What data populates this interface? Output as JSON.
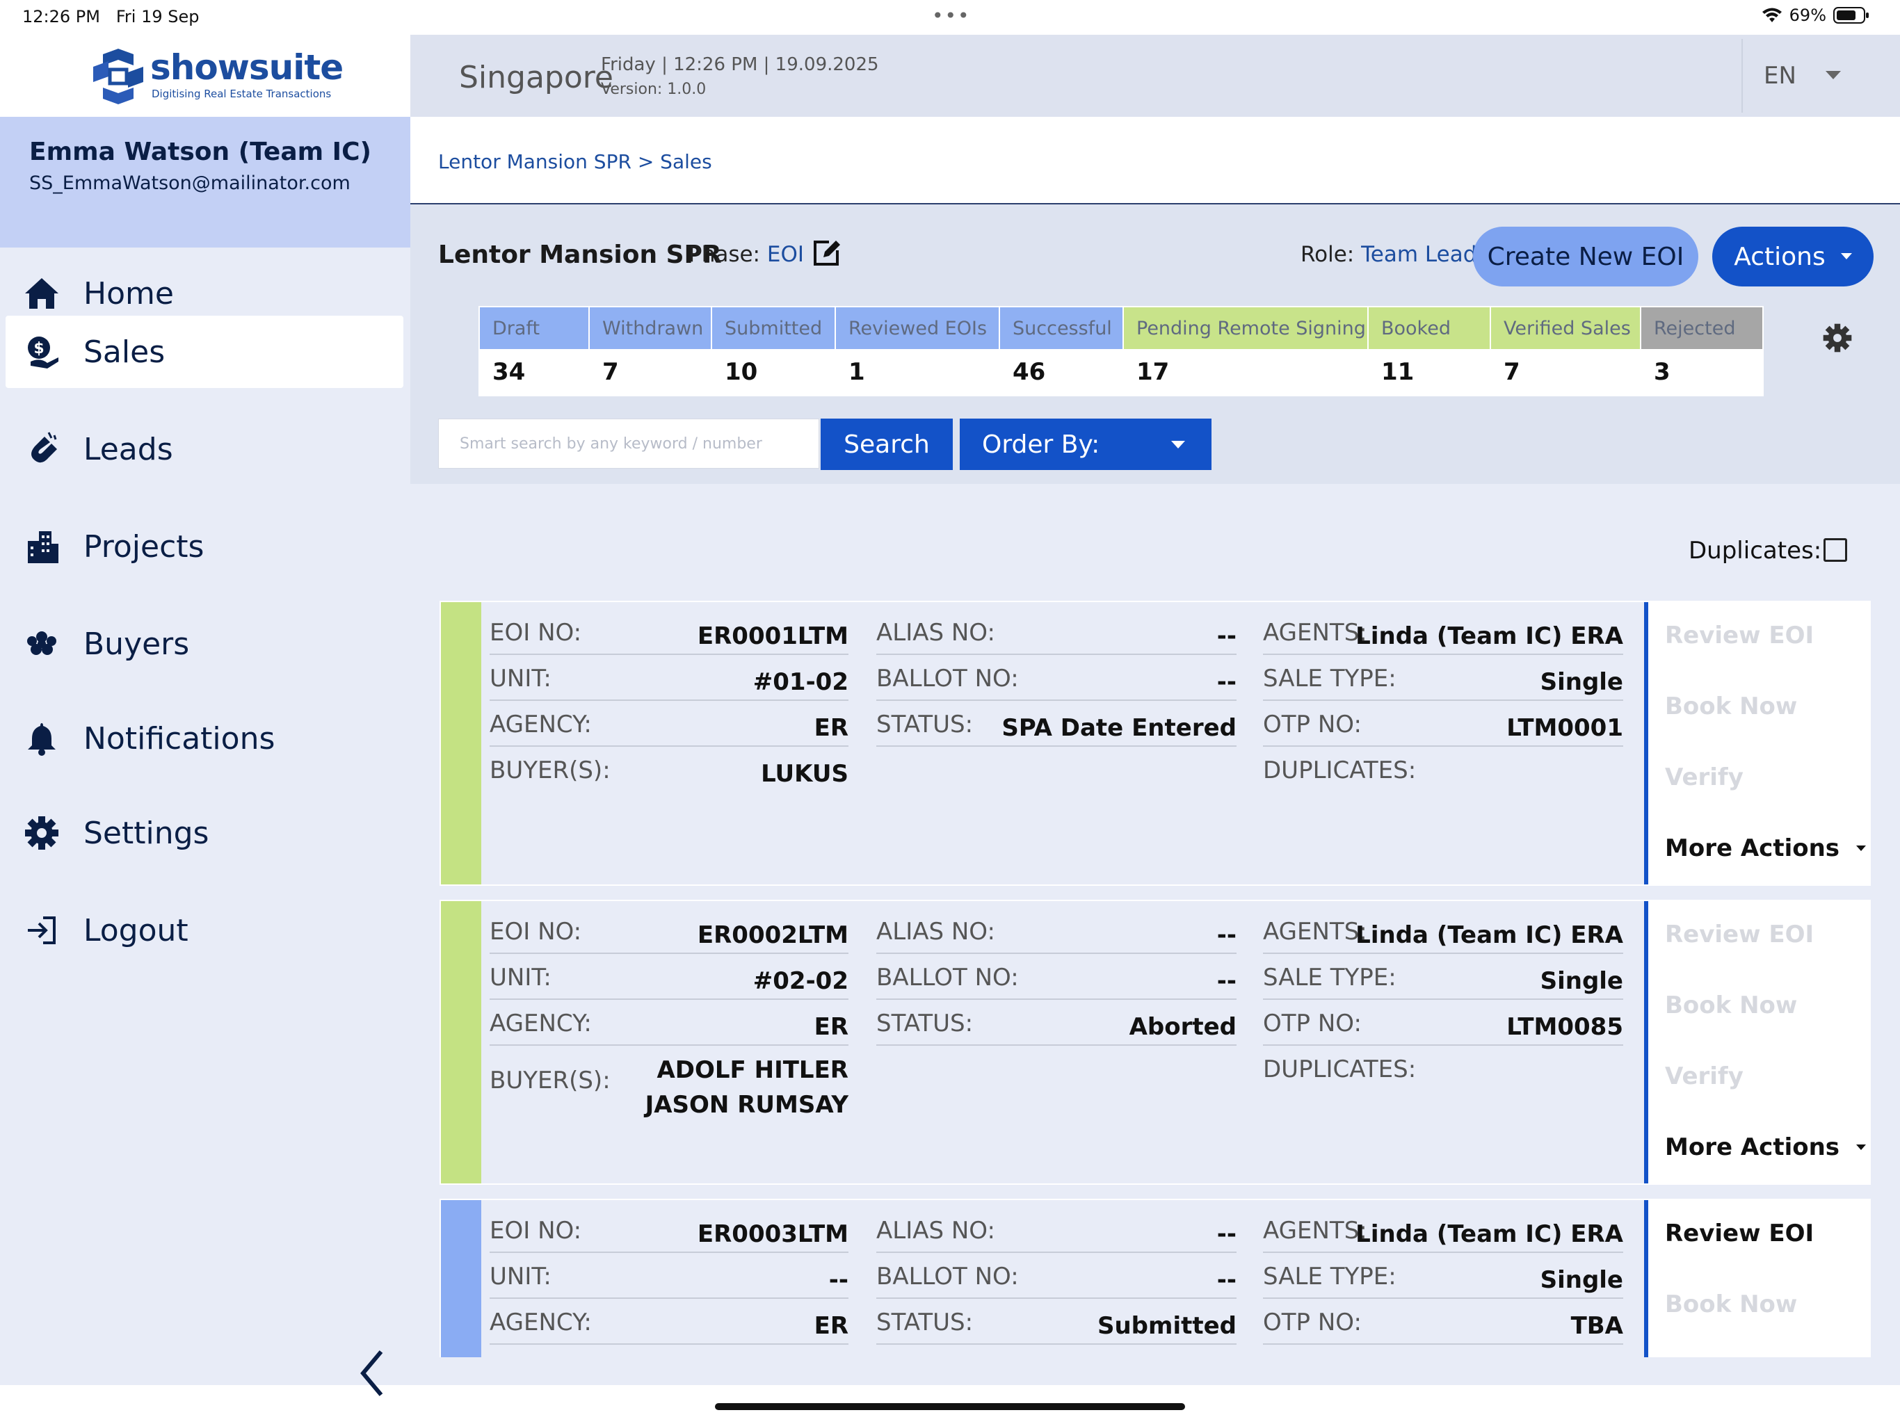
{
  "status_bar": {
    "time": "12:26 PM",
    "date": "Fri 19 Sep",
    "battery": "69%"
  },
  "app": {
    "logo_text": "showsuite",
    "logo_tagline": "Digitising Real Estate Transactions"
  },
  "user": {
    "name": "Emma Watson (Team IC)",
    "email": "SS_EmmaWatson@mailinator.com"
  },
  "nav": [
    {
      "label": "Home",
      "icon": "home-icon"
    },
    {
      "label": "Sales",
      "icon": "sales-icon",
      "active": true
    },
    {
      "label": "Leads",
      "icon": "magnet-icon"
    },
    {
      "label": "Projects",
      "icon": "buildings-icon"
    },
    {
      "label": "Buyers",
      "icon": "people-icon"
    },
    {
      "label": "Notifications",
      "icon": "bell-icon"
    },
    {
      "label": "Settings",
      "icon": "gear-icon"
    },
    {
      "label": "Logout",
      "icon": "logout-icon"
    }
  ],
  "header": {
    "city": "Singapore",
    "datetime": "Friday | 12:26 PM | 19.09.2025",
    "version": "Version: 1.0.0",
    "language": "EN"
  },
  "breadcrumb": "Lentor Mansion SPR > Sales",
  "project": {
    "name": "Lentor Mansion SPR",
    "phase_label": "Phase:",
    "phase_value": "EOI",
    "role_label": "Role:",
    "role_value": "Team Lead",
    "create_button": "Create New EOI",
    "actions_button": "Actions"
  },
  "stats": [
    {
      "label": "Draft",
      "value": "34",
      "color": "#8fb0f3"
    },
    {
      "label": "Withdrawn",
      "value": "7",
      "color": "#8fb0f3"
    },
    {
      "label": "Submitted",
      "value": "10",
      "color": "#8fb0f3"
    },
    {
      "label": "Reviewed EOIs",
      "value": "1",
      "color": "#8fb0f3"
    },
    {
      "label": "Successful",
      "value": "46",
      "color": "#8fb0f3"
    },
    {
      "label": "Pending Remote Signing",
      "value": "17",
      "color": "#c8e38a"
    },
    {
      "label": "Booked",
      "value": "11",
      "color": "#c8e38a"
    },
    {
      "label": "Verified Sales",
      "value": "7",
      "color": "#c8e38a"
    },
    {
      "label": "Rejected",
      "value": "3",
      "color": "#a6a6a6"
    }
  ],
  "search": {
    "placeholder": "Smart search by any keyword / number",
    "button": "Search",
    "order_by": "Order By:"
  },
  "duplicates_label": "Duplicates:",
  "field_labels": {
    "eoi_no": "EOI NO:",
    "unit": "UNIT:",
    "agency": "AGENCY:",
    "buyers": "BUYER(S):",
    "alias_no": "ALIAS NO:",
    "ballot_no": "BALLOT NO:",
    "status": "STATUS:",
    "agents": "AGENTS:",
    "sale_type": "SALE TYPE:",
    "otp_no": "OTP NO:",
    "duplicates": "DUPLICATES:"
  },
  "action_labels": {
    "review": "Review EOI",
    "book": "Book Now",
    "verify": "Verify",
    "more": "More Actions"
  },
  "cards": [
    {
      "stripe_color": "#c4e283",
      "eoi_no": "ER0001LTM",
      "unit": "#01-02",
      "agency": "ER",
      "buyers": [
        "LUKUS"
      ],
      "alias_no": "--",
      "ballot_no": "--",
      "status": "SPA Date Entered",
      "agents": "Linda (Team IC) ERA",
      "sale_type": "Single",
      "otp_no": "LTM0001",
      "duplicates": "",
      "review_enabled": false
    },
    {
      "stripe_color": "#c4e283",
      "eoi_no": "ER0002LTM",
      "unit": "#02-02",
      "agency": "ER",
      "buyers": [
        "ADOLF HITLER",
        "JASON RUMSAY"
      ],
      "alias_no": "--",
      "ballot_no": "--",
      "status": "Aborted",
      "agents": "Linda (Team IC) ERA",
      "sale_type": "Single",
      "otp_no": "LTM0085",
      "duplicates": "",
      "review_enabled": false
    },
    {
      "stripe_color": "#8aacf3",
      "eoi_no": "ER0003LTM",
      "unit": "--",
      "agency": "ER",
      "buyers": [],
      "alias_no": "--",
      "ballot_no": "--",
      "status": "Submitted",
      "agents": "Linda (Team IC) ERA",
      "sale_type": "Single",
      "otp_no": "TBA",
      "duplicates": "",
      "review_enabled": true
    }
  ]
}
